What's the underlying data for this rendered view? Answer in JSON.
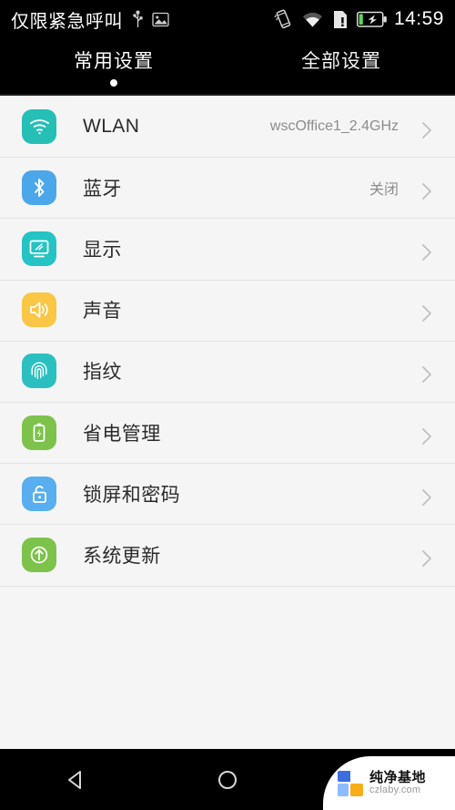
{
  "statusbar": {
    "carrier": "仅限紧急呼叫",
    "time": "14:59",
    "left_icons": [
      "usb-icon",
      "screenshot-icon"
    ],
    "right_icons": [
      "vibrate-icon",
      "wifi-icon",
      "sim-alert-icon",
      "battery-charging-icon"
    ]
  },
  "tabs": [
    {
      "label": "常用设置",
      "active": true
    },
    {
      "label": "全部设置",
      "active": false
    }
  ],
  "settings": {
    "rows": [
      {
        "icon": "wifi-icon",
        "label": "WLAN",
        "value": "wscOffice1_2.4GHz",
        "color": "#25bfb5"
      },
      {
        "icon": "bluetooth-icon",
        "label": "蓝牙",
        "value": "关闭",
        "color": "#4ba7ea"
      },
      {
        "icon": "display-icon",
        "label": "显示",
        "value": "",
        "color": "#25c3c3"
      },
      {
        "icon": "sound-icon",
        "label": "声音",
        "value": "",
        "color": "#f9c645"
      },
      {
        "icon": "fingerprint-icon",
        "label": "指纹",
        "value": "",
        "color": "#2cbfc0"
      },
      {
        "icon": "battery-icon",
        "label": "省电管理",
        "value": "",
        "color": "#7dc24b"
      },
      {
        "icon": "lock-icon",
        "label": "锁屏和密码",
        "value": "",
        "color": "#58aeee"
      },
      {
        "icon": "update-icon",
        "label": "系统更新",
        "value": "",
        "color": "#7dc24b"
      }
    ]
  },
  "navbar": {
    "back_label": "back-button",
    "home_label": "home-button",
    "recents_label": "recents-button"
  },
  "watermark": {
    "title": "纯净基地",
    "url": "czlaby.com"
  },
  "colors": {
    "page_bg": "#f5f5f5",
    "bar_bg": "#000000",
    "divider": "#e2e2e2",
    "label": "#2b2b2b",
    "value": "#8c8c8c"
  }
}
